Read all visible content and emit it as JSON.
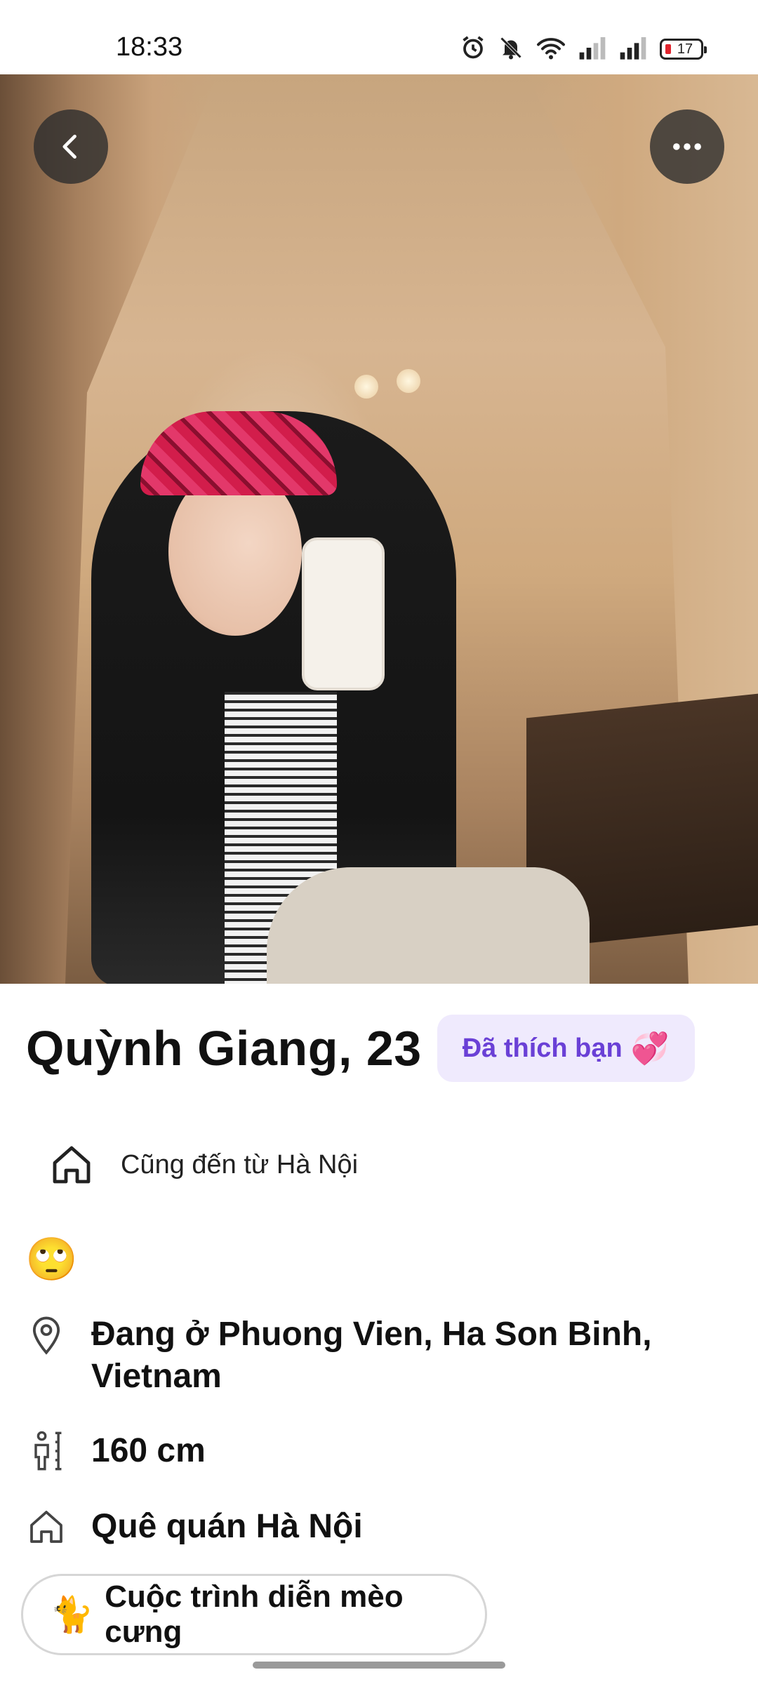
{
  "status_bar": {
    "time": "18:33",
    "battery": "17",
    "icons": [
      "alarm-icon",
      "mute-icon",
      "wifi-icon",
      "signal-icon",
      "signal-icon",
      "battery-icon"
    ]
  },
  "photo": {
    "back_icon": "chevron-left-icon",
    "more_icon": "more-horizontal-icon"
  },
  "profile": {
    "name_age": "Quỳnh Giang, 23",
    "liked_badge": "Đã thích bạn",
    "liked_emoji": "💞",
    "hometown_match": "Cũng đến từ Hà Nội",
    "status_emoji": "🙄",
    "location": "Đang ở Phuong Vien, Ha Son Binh, Vietnam",
    "height": "160 cm",
    "hometown": "Quê quán Hà Nội"
  },
  "prompt": {
    "emoji": "🐈",
    "label": "Cuộc trình diễn mèo cưng"
  },
  "colors": {
    "accent": "#6a40d6",
    "badge_bg": "#efeafd",
    "heart": "#e0245e"
  }
}
